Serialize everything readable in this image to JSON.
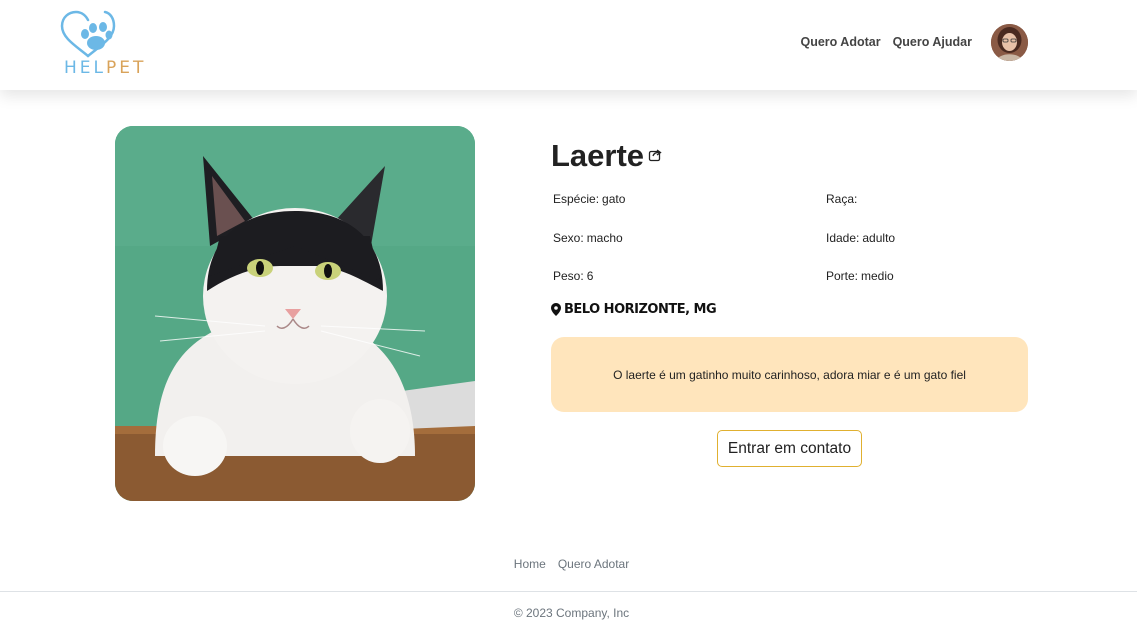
{
  "header": {
    "logo": {
      "text_left": "HEL",
      "text_right": "PET",
      "icon": "paw-heart-icon"
    },
    "nav": [
      {
        "label": "Quero Adotar"
      },
      {
        "label": "Quero Ajudar"
      }
    ],
    "avatar_icon": "user-avatar"
  },
  "pet": {
    "name": "Laerte",
    "share_icon": "share-icon",
    "attributes": {
      "especie": {
        "label": "Espécie:",
        "value": "gato"
      },
      "raca": {
        "label": "Raça:",
        "value": ""
      },
      "sexo": {
        "label": "Sexo:",
        "value": "macho"
      },
      "idade": {
        "label": "Idade:",
        "value": "adulto"
      },
      "peso": {
        "label": "Peso:",
        "value": "6"
      },
      "porte": {
        "label": "Porte:",
        "value": "medio"
      }
    },
    "location": "BELO HORIZONTE, MG",
    "location_icon": "map-pin-icon",
    "description": "O laerte é um gatinho muito carinhoso, adora miar e é um gato fiel",
    "contact_button": "Entrar em contato",
    "photo": "cat-photo"
  },
  "footer": {
    "nav": [
      {
        "label": "Home"
      },
      {
        "label": "Quero Adotar"
      }
    ],
    "copyright": "© 2023 Company, Inc"
  },
  "colors": {
    "logo_blue": "#6cb8e6",
    "logo_gold": "#d9a35a",
    "description_bg": "#ffe5bc",
    "contact_border": "#e0b030"
  }
}
